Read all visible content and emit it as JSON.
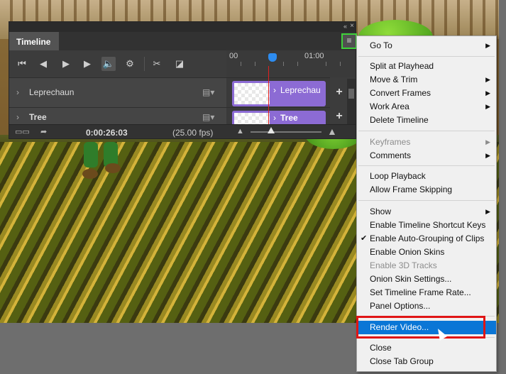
{
  "timeline": {
    "tab_label": "Timeline",
    "collapse_icon": "double-chevron-left",
    "close_icon": "close",
    "menu_icon": "hamburger",
    "ruler": {
      "start": "00",
      "mark": "01:00"
    },
    "tracks": [
      {
        "name": "Leprechaun",
        "clip_label": "Leprechau"
      },
      {
        "name": "Tree",
        "clip_label": "Tree"
      }
    ],
    "current_time": "0:00:26:03",
    "fps": "(25.00 fps)",
    "playhead_color": "#2d8cf0",
    "clip_color": "#8c6bd4"
  },
  "menu": {
    "items": [
      {
        "label": "Go To",
        "submenu": true
      },
      {
        "label": "Split at Playhead"
      },
      {
        "label": "Move & Trim",
        "submenu": true
      },
      {
        "label": "Convert Frames",
        "submenu": true
      },
      {
        "label": "Work Area",
        "submenu": true
      },
      {
        "label": "Delete Timeline"
      },
      {
        "label": "Keyframes",
        "submenu": true,
        "disabled": true
      },
      {
        "label": "Comments",
        "submenu": true
      },
      {
        "label": "Loop Playback"
      },
      {
        "label": "Allow Frame Skipping"
      },
      {
        "label": "Show",
        "submenu": true
      },
      {
        "label": "Enable Timeline Shortcut Keys"
      },
      {
        "label": "Enable Auto-Grouping of Clips",
        "checked": true
      },
      {
        "label": "Enable Onion Skins"
      },
      {
        "label": "Enable 3D Tracks",
        "disabled": true
      },
      {
        "label": "Onion Skin Settings..."
      },
      {
        "label": "Set Timeline Frame Rate..."
      },
      {
        "label": "Panel Options..."
      },
      {
        "label": "Render Video...",
        "highlighted": true
      },
      {
        "label": "Close"
      },
      {
        "label": "Close Tab Group"
      }
    ],
    "highlight_color": "#0a76d6",
    "callout_color": "#e01515"
  }
}
